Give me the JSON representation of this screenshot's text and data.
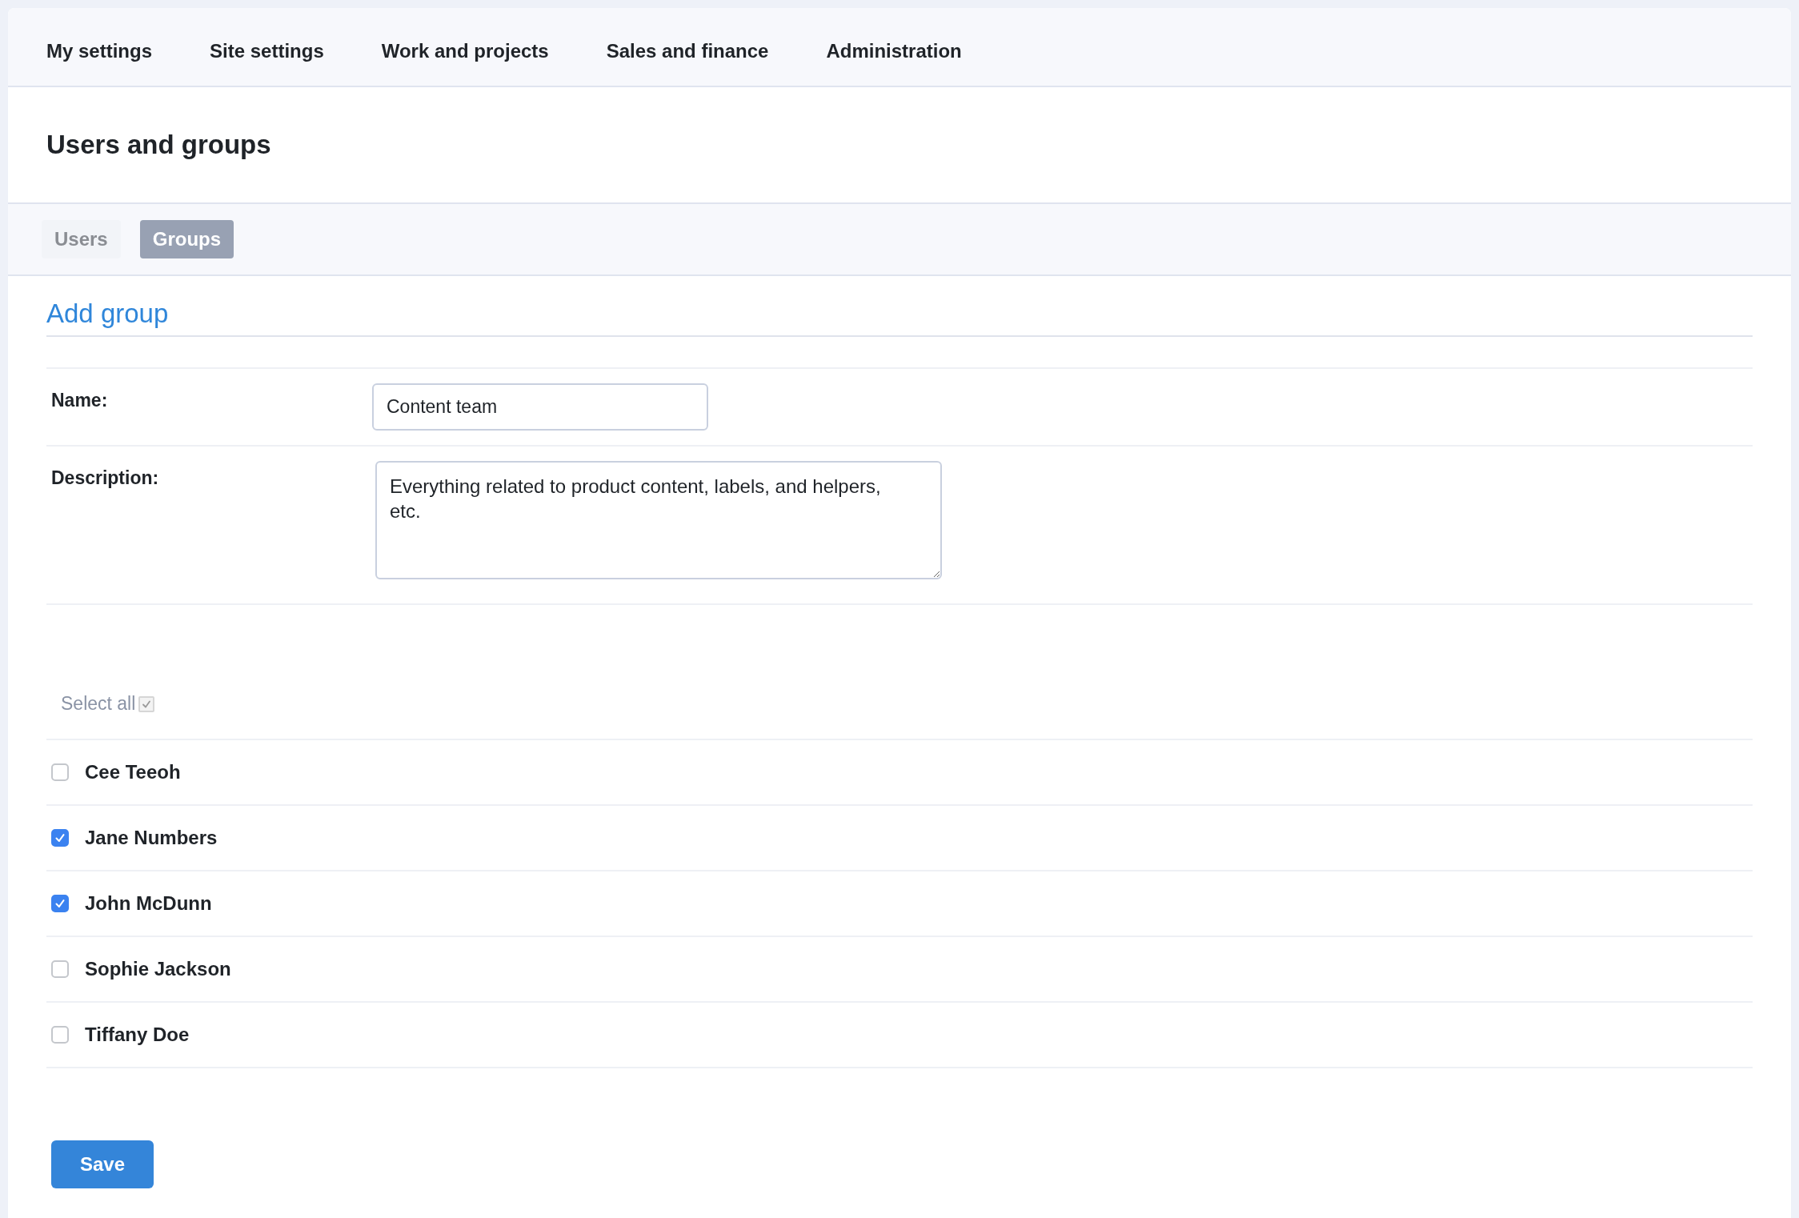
{
  "nav": [
    {
      "label": "My settings"
    },
    {
      "label": "Site settings"
    },
    {
      "label": "Work and projects"
    },
    {
      "label": "Sales and finance"
    },
    {
      "label": "Administration"
    }
  ],
  "page_title": "Users and groups",
  "tabs": [
    {
      "label": "Users",
      "selected": false
    },
    {
      "label": "Groups",
      "selected": true
    }
  ],
  "section_title": "Add group",
  "fields": [
    {
      "kind": "input",
      "label": "Name:",
      "value": "Content team"
    },
    {
      "kind": "textarea",
      "label": "Description:",
      "value": "Everything related to product content, labels, and helpers, etc."
    }
  ],
  "select_all": {
    "label": "Select all",
    "checked": true,
    "disabled": true
  },
  "members": [
    {
      "name": "Cee Teeoh",
      "checked": false
    },
    {
      "name": "Jane Numbers",
      "checked": true
    },
    {
      "name": "John McDunn",
      "checked": true
    },
    {
      "name": "Sophie Jackson",
      "checked": false
    },
    {
      "name": "Tiffany Doe",
      "checked": false
    }
  ],
  "save_button": "Save"
}
